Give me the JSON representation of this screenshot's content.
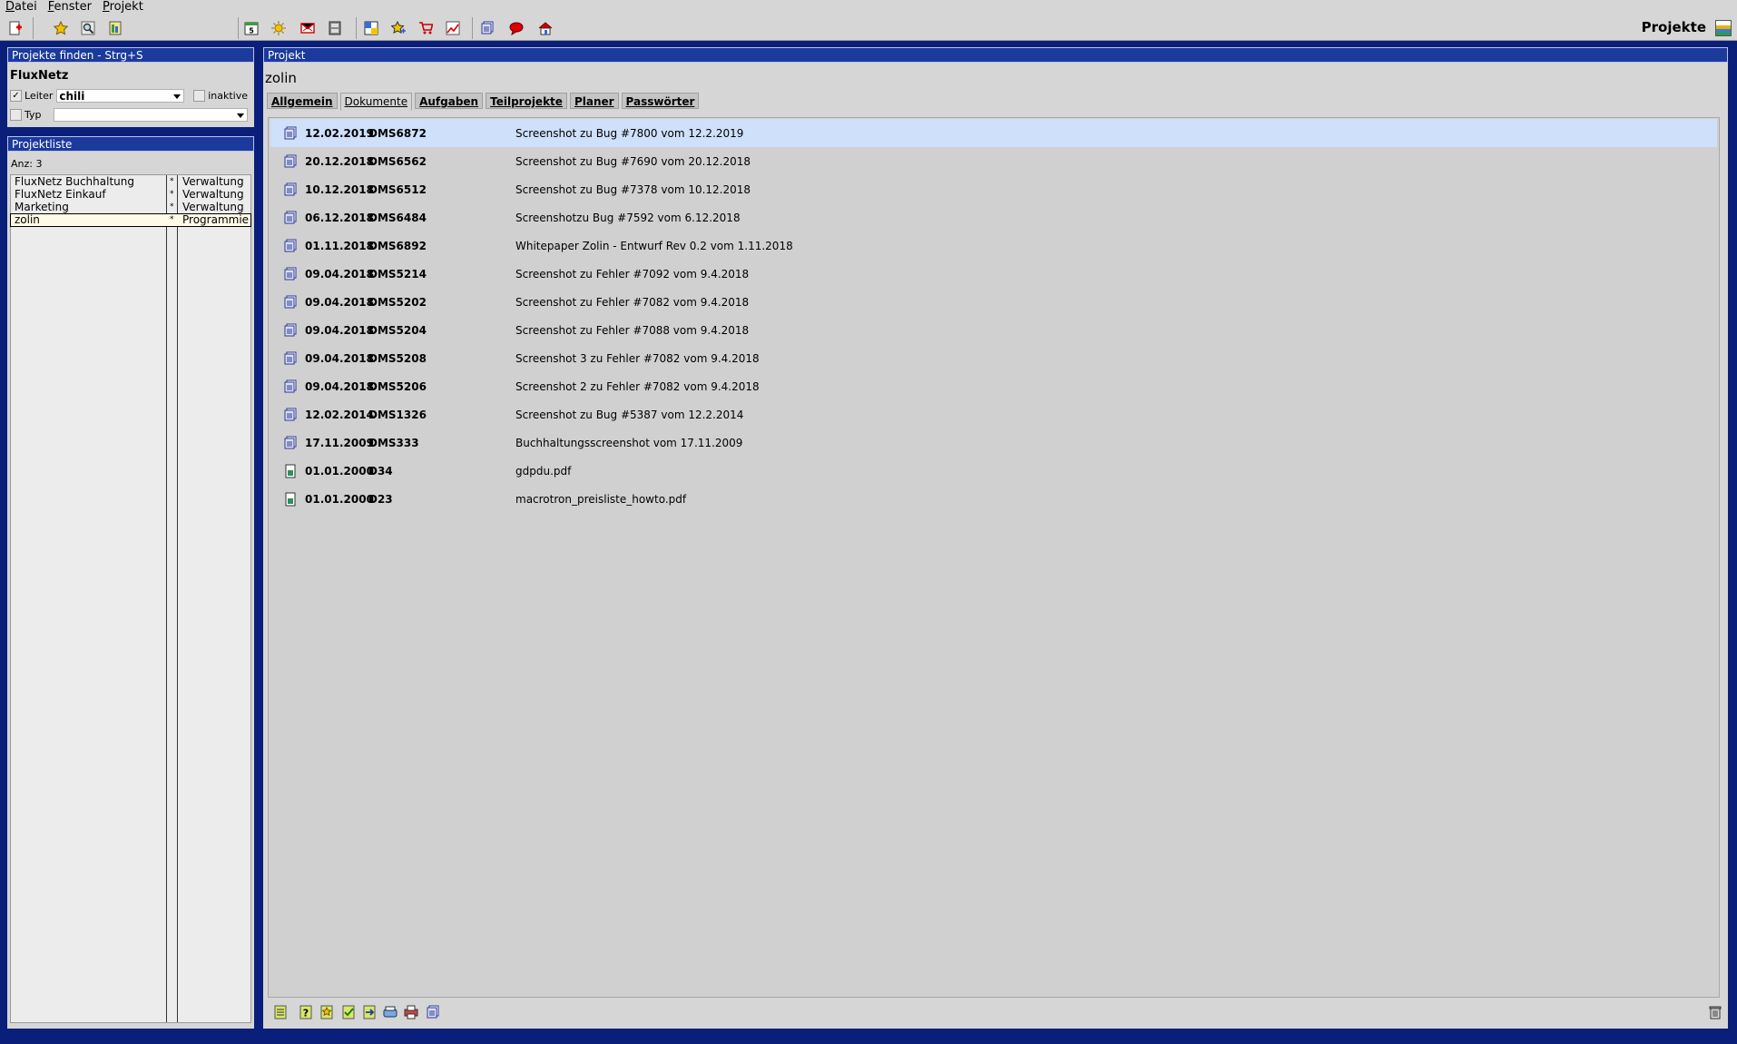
{
  "menu": {
    "items": [
      "Datei",
      "Fenster",
      "Projekt"
    ]
  },
  "toolbar": {
    "title": "Projekte",
    "icons": [
      "new-project-icon",
      "star-icon",
      "search-icon",
      "report-icon",
      "calendar-icon",
      "sun-icon",
      "mail-delete-icon",
      "archive-icon",
      "sticky-note-icon",
      "star-add-icon",
      "cart-icon",
      "chart-icon",
      "documents-icon",
      "speech-bubble-icon",
      "home-icon"
    ]
  },
  "find": {
    "header": "Projekte finden - Strg+S",
    "name": "FluxNetz",
    "leiter_label": "Leiter",
    "leiter_checked": "✓",
    "leiter_value": "chili",
    "inaktive_label": "inaktive",
    "typ_label": "Typ",
    "typ_value": ""
  },
  "projektliste": {
    "header": "Projektliste",
    "count": "Anz: 3",
    "items": [
      {
        "name": "FluxNetz Buchhaltung",
        "star": "*",
        "category": "Verwaltung"
      },
      {
        "name": "FluxNetz Einkauf",
        "star": "*",
        "category": "Verwaltung"
      },
      {
        "name": "Marketing",
        "star": "*",
        "category": "Verwaltung"
      },
      {
        "name": "zolin",
        "star": "*",
        "category": "Programmieru"
      }
    ]
  },
  "project": {
    "header": "Projekt",
    "name": "zolin",
    "tabs": [
      "Allgemein",
      "Dokumente",
      "Aufgaben",
      "Teilprojekte",
      "Planer",
      "Passwörter"
    ],
    "active_tab": 1
  },
  "documents": [
    {
      "date": "12.02.2019",
      "id": "DMS6872",
      "title": "Screenshot zu Bug #7800 vom 12.2.2019",
      "icon": "dms-icon"
    },
    {
      "date": "20.12.2018",
      "id": "DMS6562",
      "title": "Screenshot zu Bug #7690 vom 20.12.2018",
      "icon": "dms-icon"
    },
    {
      "date": "10.12.2018",
      "id": "DMS6512",
      "title": "Screenshot zu Bug #7378 vom 10.12.2018",
      "icon": "dms-icon"
    },
    {
      "date": "06.12.2018",
      "id": "DMS6484",
      "title": "Screenshotzu  Bug #7592 vom 6.12.2018",
      "icon": "dms-icon"
    },
    {
      "date": "01.11.2018",
      "id": "DMS6892",
      "title": "Whitepaper Zolin - Entwurf Rev 0.2 vom 1.11.2018",
      "icon": "dms-icon"
    },
    {
      "date": "09.04.2018",
      "id": "DMS5214",
      "title": "Screenshot zu Fehler #7092 vom 9.4.2018",
      "icon": "dms-icon"
    },
    {
      "date": "09.04.2018",
      "id": "DMS5202",
      "title": "Screenshot zu Fehler #7082 vom 9.4.2018",
      "icon": "dms-icon"
    },
    {
      "date": "09.04.2018",
      "id": "DMS5204",
      "title": "Screenshot zu Fehler #7088 vom 9.4.2018",
      "icon": "dms-icon"
    },
    {
      "date": "09.04.2018",
      "id": "DMS5208",
      "title": "Screenshot 3 zu Fehler #7082 vom 9.4.2018",
      "icon": "dms-icon"
    },
    {
      "date": "09.04.2018",
      "id": "DMS5206",
      "title": "Screenshot 2 zu Fehler #7082 vom 9.4.2018",
      "icon": "dms-icon"
    },
    {
      "date": "12.02.2014",
      "id": "DMS1326",
      "title": "Screenshot zu Bug #5387 vom 12.2.2014",
      "icon": "dms-icon"
    },
    {
      "date": "17.11.2009",
      "id": "DMS333",
      "title": "Buchhaltungsscreenshot vom 17.11.2009",
      "icon": "dms-icon"
    },
    {
      "date": "01.01.2000",
      "id": "D34",
      "title": "gdpdu.pdf",
      "icon": "file-icon"
    },
    {
      "date": "01.01.2000",
      "id": "D23",
      "title": "macrotron_preisliste_howto.pdf",
      "icon": "file-icon"
    }
  ],
  "bottom_icons": [
    "list-icon",
    "help-icon",
    "new-doc-icon",
    "check-icon",
    "export-icon",
    "scan-icon",
    "print-icon",
    "dms-icon",
    "trash-icon"
  ],
  "colors": {
    "header_bg": "#1c3a9c",
    "selection": "#cfe0fb",
    "frame": "#0a1f7a"
  }
}
